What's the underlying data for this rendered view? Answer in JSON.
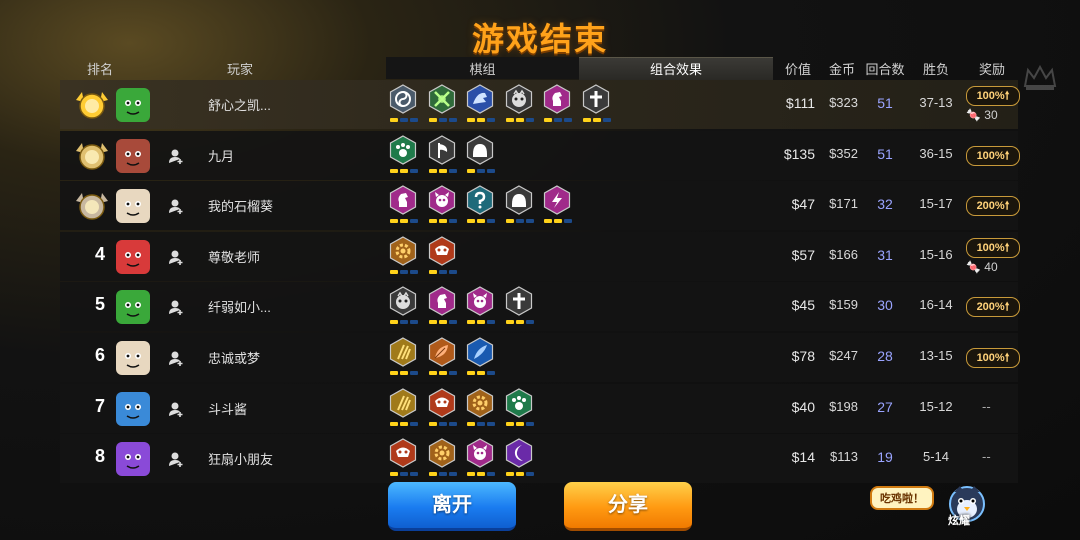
{
  "title": "游戏结束",
  "headers": {
    "rank": "排名",
    "player": "玩家",
    "pieces": "棋组",
    "combo": "组合效果",
    "value": "价值",
    "gold": "金币",
    "rounds": "回合数",
    "winloss": "胜负",
    "reward": "奖励"
  },
  "rows": [
    {
      "rank": "1",
      "name": "舒心之凯...",
      "value": "$111",
      "gold": "$323",
      "rounds": "51",
      "wl": "37-13",
      "reward": "100%🠕",
      "reward_extra": "30",
      "me": true,
      "traits": [
        {
          "icon": "yinyang",
          "color": "#4a5a6a",
          "bars": [
            1,
            0,
            0
          ]
        },
        {
          "icon": "crossed-arrows",
          "color": "#2f6b3a",
          "bars": [
            1,
            0,
            0
          ]
        },
        {
          "icon": "dragon",
          "color": "#2a4fa8",
          "bars": [
            1,
            1,
            0
          ]
        },
        {
          "icon": "beast",
          "color": "#3a3a3a",
          "bars": [
            1,
            1,
            0
          ]
        },
        {
          "icon": "knight",
          "color": "#a02a8a",
          "bars": [
            1,
            0,
            0
          ]
        },
        {
          "icon": "cross",
          "color": "#3a3a3a",
          "bars": [
            1,
            1,
            0
          ]
        }
      ]
    },
    {
      "rank": "2",
      "name": "九月",
      "value": "$135",
      "gold": "$352",
      "rounds": "51",
      "wl": "36-15",
      "reward": "100%🠕",
      "reward_extra": "",
      "traits": [
        {
          "icon": "paw",
          "color": "#1f7a4a",
          "bars": [
            1,
            1,
            0
          ]
        },
        {
          "icon": "axe",
          "color": "#3a3a3a",
          "bars": [
            1,
            1,
            0
          ]
        },
        {
          "icon": "helmet",
          "color": "#3a3a3a",
          "bars": [
            1,
            0,
            0
          ]
        }
      ]
    },
    {
      "rank": "3",
      "name": "我的石榴葵",
      "value": "$47",
      "gold": "$171",
      "rounds": "32",
      "wl": "15-17",
      "reward": "200%🠕",
      "reward_extra": "",
      "traits": [
        {
          "icon": "knight",
          "color": "#a02a8a",
          "bars": [
            1,
            1,
            0
          ]
        },
        {
          "icon": "demon",
          "color": "#a02a8a",
          "bars": [
            1,
            1,
            0
          ]
        },
        {
          "icon": "question",
          "color": "#1f6a7a",
          "bars": [
            1,
            1,
            0
          ]
        },
        {
          "icon": "helmet",
          "color": "#3a3a3a",
          "bars": [
            1,
            0,
            0
          ]
        },
        {
          "icon": "bolt",
          "color": "#a02a8a",
          "bars": [
            1,
            1,
            0
          ]
        }
      ]
    },
    {
      "rank": "4",
      "name": "尊敬老师",
      "value": "$57",
      "gold": "$166",
      "rounds": "31",
      "wl": "15-16",
      "reward": "100%🠕",
      "reward_extra": "40",
      "traits": [
        {
          "icon": "gear",
          "color": "#a0621a",
          "bars": [
            1,
            0,
            0
          ]
        },
        {
          "icon": "mech",
          "color": "#b03a1a",
          "bars": [
            1,
            0,
            0
          ]
        }
      ]
    },
    {
      "rank": "5",
      "name": "纤弱如小...",
      "value": "$45",
      "gold": "$159",
      "rounds": "30",
      "wl": "16-14",
      "reward": "200%🠕",
      "reward_extra": "",
      "traits": [
        {
          "icon": "beast",
          "color": "#3a3a3a",
          "bars": [
            1,
            0,
            0
          ]
        },
        {
          "icon": "knight",
          "color": "#a02a8a",
          "bars": [
            1,
            1,
            0
          ]
        },
        {
          "icon": "demon",
          "color": "#a02a8a",
          "bars": [
            1,
            1,
            0
          ]
        },
        {
          "icon": "cross",
          "color": "#3a3a3a",
          "bars": [
            1,
            1,
            0
          ]
        }
      ]
    },
    {
      "rank": "6",
      "name": "忠诚或梦",
      "value": "$78",
      "gold": "$247",
      "rounds": "28",
      "wl": "13-15",
      "reward": "100%🠕",
      "reward_extra": "",
      "traits": [
        {
          "icon": "claws",
          "color": "#a07a1a",
          "bars": [
            1,
            1,
            0
          ]
        },
        {
          "icon": "leaf",
          "color": "#b05a1a",
          "bars": [
            1,
            1,
            0
          ]
        },
        {
          "icon": "feather",
          "color": "#1a5ab0",
          "bars": [
            1,
            1,
            0
          ]
        }
      ]
    },
    {
      "rank": "7",
      "name": "斗斗酱",
      "value": "$40",
      "gold": "$198",
      "rounds": "27",
      "wl": "15-12",
      "reward": "",
      "reward_extra": "",
      "traits": [
        {
          "icon": "claws",
          "color": "#a07a1a",
          "bars": [
            1,
            1,
            0
          ]
        },
        {
          "icon": "mech",
          "color": "#b03a1a",
          "bars": [
            1,
            0,
            0
          ]
        },
        {
          "icon": "gear",
          "color": "#a0621a",
          "bars": [
            1,
            0,
            0
          ]
        },
        {
          "icon": "paw",
          "color": "#1f7a4a",
          "bars": [
            1,
            1,
            0
          ]
        }
      ]
    },
    {
      "rank": "8",
      "name": "狂扇小朋友",
      "value": "$14",
      "gold": "$113",
      "rounds": "19",
      "wl": "5-14",
      "reward": "",
      "reward_extra": "",
      "traits": [
        {
          "icon": "mech",
          "color": "#b03a1a",
          "bars": [
            1,
            0,
            0
          ]
        },
        {
          "icon": "gear",
          "color": "#a0621a",
          "bars": [
            1,
            0,
            0
          ]
        },
        {
          "icon": "demon",
          "color": "#a02a8a",
          "bars": [
            1,
            1,
            0
          ]
        },
        {
          "icon": "moon",
          "color": "#6a2aa8",
          "bars": [
            1,
            1,
            0
          ]
        }
      ]
    }
  ],
  "no_reward": "--",
  "buttons": {
    "leave": "离开",
    "share": "分享"
  },
  "bubble": "吃鸡啦！",
  "mascot_label": "炫耀"
}
